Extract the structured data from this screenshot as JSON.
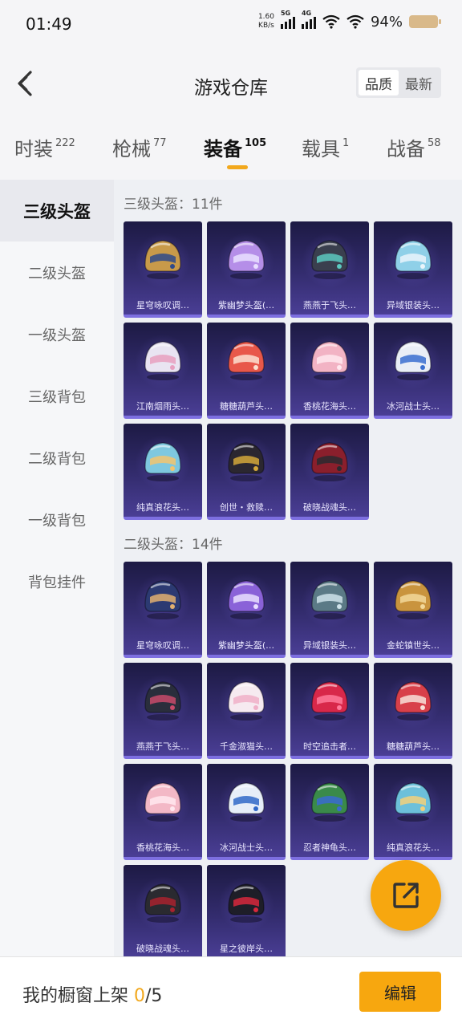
{
  "status_bar": {
    "time": "01:49",
    "net_speed": "1.60",
    "net_unit": "KB/s",
    "sig1": "5G",
    "sig2": "4G",
    "battery": "94%"
  },
  "header": {
    "title": "游戏仓库",
    "sort_options": [
      "品质",
      "最新"
    ]
  },
  "tabs": [
    {
      "label": "时装",
      "count": "222"
    },
    {
      "label": "枪械",
      "count": "77"
    },
    {
      "label": "装备",
      "count": "105"
    },
    {
      "label": "载具",
      "count": "1"
    },
    {
      "label": "战备",
      "count": "58"
    }
  ],
  "sidebar": [
    "三级头盔",
    "二级头盔",
    "一级头盔",
    "三级背包",
    "二级背包",
    "一级背包",
    "背包挂件"
  ],
  "sections": [
    {
      "title": "三级头盔：11件",
      "items": [
        {
          "name": "星穹咏叹调…",
          "color": "#c89a4a",
          "accent": "#2f4a8a"
        },
        {
          "name": "紫幽梦头盔(…",
          "color": "#b58ee8",
          "accent": "#e9e0ff"
        },
        {
          "name": "燕燕于飞头…",
          "color": "#3a3f4e",
          "accent": "#5cc9c0"
        },
        {
          "name": "异域银装头…",
          "color": "#8fd0e8",
          "accent": "#eaf5fb"
        },
        {
          "name": "江南烟雨头…",
          "color": "#e9e4f2",
          "accent": "#e8a0c0"
        },
        {
          "name": "糖糖葫芦头…",
          "color": "#e8584a",
          "accent": "#fbe0d0"
        },
        {
          "name": "香桃花海头…",
          "color": "#f2b3c4",
          "accent": "#ffe8ef"
        },
        {
          "name": "冰河战士头…",
          "color": "#e9eef6",
          "accent": "#3a6fd0"
        },
        {
          "name": "纯真浪花头…",
          "color": "#7ec8df",
          "accent": "#f2c46e"
        },
        {
          "name": "创世・救赎…",
          "color": "#2b2730",
          "accent": "#d4a83a"
        },
        {
          "name": "破晓战魂头…",
          "color": "#8a1f2c",
          "accent": "#2a2a30"
        }
      ]
    },
    {
      "title": "二级头盔：14件",
      "items": [
        {
          "name": "星穹咏叹调…",
          "color": "#2c3a72",
          "accent": "#e0b070"
        },
        {
          "name": "紫幽梦头盔(…",
          "color": "#8a62d8",
          "accent": "#e9e0ff"
        },
        {
          "name": "异域银装头…",
          "color": "#5b7a86",
          "accent": "#cfe3ea"
        },
        {
          "name": "金蛇镇世头…",
          "color": "#c9943e",
          "accent": "#f2d89a"
        },
        {
          "name": "燕燕于飞头…",
          "color": "#2a2e3c",
          "accent": "#c84a6a"
        },
        {
          "name": "千金淑猫头…",
          "color": "#f6eaf0",
          "accent": "#f0b0c8"
        },
        {
          "name": "时空追击者…",
          "color": "#d8284a",
          "accent": "#ff7a9a"
        },
        {
          "name": "糖糖葫芦头…",
          "color": "#d8404a",
          "accent": "#f8e0d8"
        },
        {
          "name": "香桃花海头…",
          "color": "#f3b8c6",
          "accent": "#ffe8ef"
        },
        {
          "name": "冰河战士头…",
          "color": "#e6eef8",
          "accent": "#2f68c8"
        },
        {
          "name": "忍者神龟头…",
          "color": "#3a8a4a",
          "accent": "#3a6ad0"
        },
        {
          "name": "纯真浪花头…",
          "color": "#6cc0da",
          "accent": "#f2d07a"
        },
        {
          "name": "破晓战魂头…",
          "color": "#2a2a30",
          "accent": "#a8222e"
        },
        {
          "name": "星之彼岸头…",
          "color": "#1e1e28",
          "accent": "#d8283c"
        }
      ]
    }
  ],
  "bottom": {
    "label_prefix": "我的橱窗上架 ",
    "count_current": "0",
    "count_sep": "/",
    "count_max": "5",
    "edit_label": "编辑"
  }
}
